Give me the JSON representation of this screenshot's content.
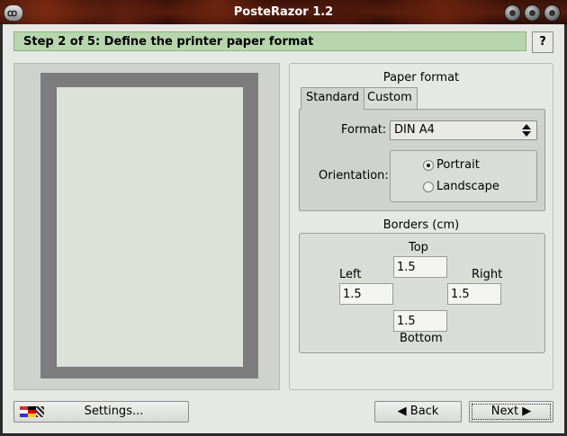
{
  "window": {
    "title": "PosteRazor 1.2",
    "menu_icon": "window-menu-icon",
    "controls": [
      "minimize-icon",
      "maximize-icon",
      "close-icon"
    ]
  },
  "step": {
    "label": "Step 2 of 5: Define the printer paper format",
    "help_label": "?"
  },
  "paper_format": {
    "title": "Paper format",
    "tabs": [
      {
        "label": "Standard",
        "active": true
      },
      {
        "label": "Custom",
        "active": false
      }
    ],
    "format_label": "Format:",
    "format_value": "DIN A4",
    "orientation_label": "Orientation:",
    "orientation_options": [
      {
        "label": "Portrait",
        "selected": true
      },
      {
        "label": "Landscape",
        "selected": false
      }
    ]
  },
  "borders": {
    "title": "Borders (cm)",
    "top_label": "Top",
    "top_value": "1.5",
    "left_label": "Left",
    "left_value": "1.5",
    "right_label": "Right",
    "right_value": "1.5",
    "bottom_label": "Bottom",
    "bottom_value": "1.5"
  },
  "footer": {
    "settings_label": "Settings...",
    "back_label": "◀ Back",
    "next_label": "Next ▶"
  },
  "colors": {
    "step_bar": "#b7d6ad",
    "preview_border": "#7c7c7c",
    "preview_paper": "#dce1da"
  }
}
